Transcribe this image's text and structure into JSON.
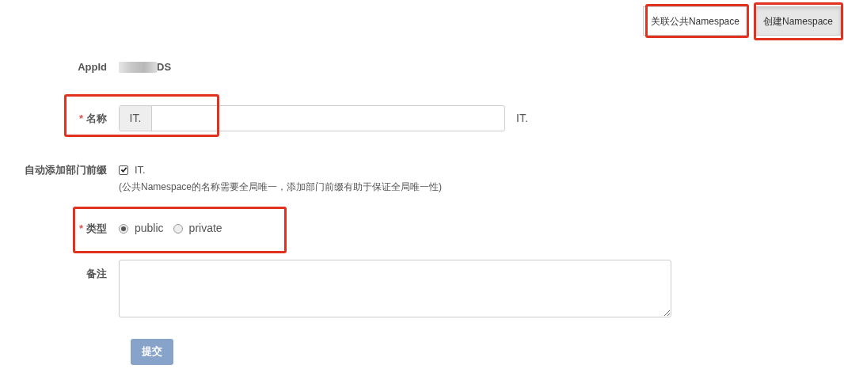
{
  "toolbar": [
    {
      "label": "关联公共Namespace",
      "kind": "plain"
    },
    {
      "label": "创建Namespace",
      "kind": "active"
    }
  ],
  "form": {
    "appid": {
      "label": "AppId",
      "value": "DS",
      "redacted": true
    },
    "name": {
      "label": "名称",
      "required_marker": "*",
      "prefix": "IT.",
      "suffix": "IT."
    },
    "dept_prefix": {
      "label": "自动添加部门前缀",
      "checked": true,
      "option": "IT.",
      "hint": "(公共Namespace的名称需要全局唯一，添加部门前缀有助于保证全局唯一性)"
    },
    "type": {
      "label": "类型",
      "required_marker": "*",
      "options": [
        {
          "label": "public",
          "selected": true
        },
        {
          "label": "private",
          "selected": false
        }
      ]
    },
    "remark": {
      "label": "备注"
    },
    "submit": {
      "label": "提交",
      "disabled": true
    }
  }
}
